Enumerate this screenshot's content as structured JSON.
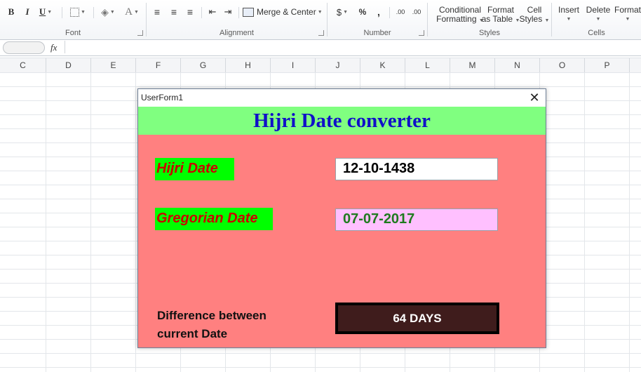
{
  "ribbon": {
    "font": {
      "label": "Font",
      "bold": "B",
      "italic": "I",
      "underline": "U",
      "font_color_glyph": "A"
    },
    "alignment": {
      "label": "Alignment",
      "merge_center": "Merge & Center"
    },
    "number": {
      "label": "Number",
      "currency": "$",
      "percent": "%",
      "comma": ",",
      "inc_decimal": ".00",
      "dec_decimal": ".00"
    },
    "styles": {
      "label": "Styles",
      "conditional_line1": "Conditional",
      "conditional_line2": "Formatting",
      "format_table_line1": "Format",
      "format_table_line2": "as Table",
      "cell_styles_line1": "Cell",
      "cell_styles_line2": "Styles"
    },
    "cells": {
      "label": "Cells",
      "insert": "Insert",
      "delete": "Delete",
      "format": "Format"
    }
  },
  "formula_bar": {
    "fx": "fx",
    "value": ""
  },
  "columns": [
    "C",
    "D",
    "E",
    "F",
    "G",
    "H",
    "I",
    "J",
    "K",
    "L",
    "M",
    "N",
    "O",
    "P"
  ],
  "form": {
    "title": "UserForm1",
    "banner": "Hijri Date converter",
    "hijri_label": "Hijri Date",
    "hijri_value": "12-10-1438",
    "gregorian_label": "Gregorian Date",
    "gregorian_value": "07-07-2017",
    "diff_label_line1": "Difference between",
    "diff_label_line2": "current Date",
    "diff_value": "64 DAYS",
    "colors": {
      "banner_bg": "#80ff80",
      "banner_text": "#1010c8",
      "body_bg": "#ff8080",
      "label_bg": "#00ff00",
      "label_text": "#cc0000",
      "gregorian_box_bg": "#ffc0ff",
      "gregorian_text": "#1f7a1f",
      "result_bg": "#3f1c1c"
    }
  }
}
